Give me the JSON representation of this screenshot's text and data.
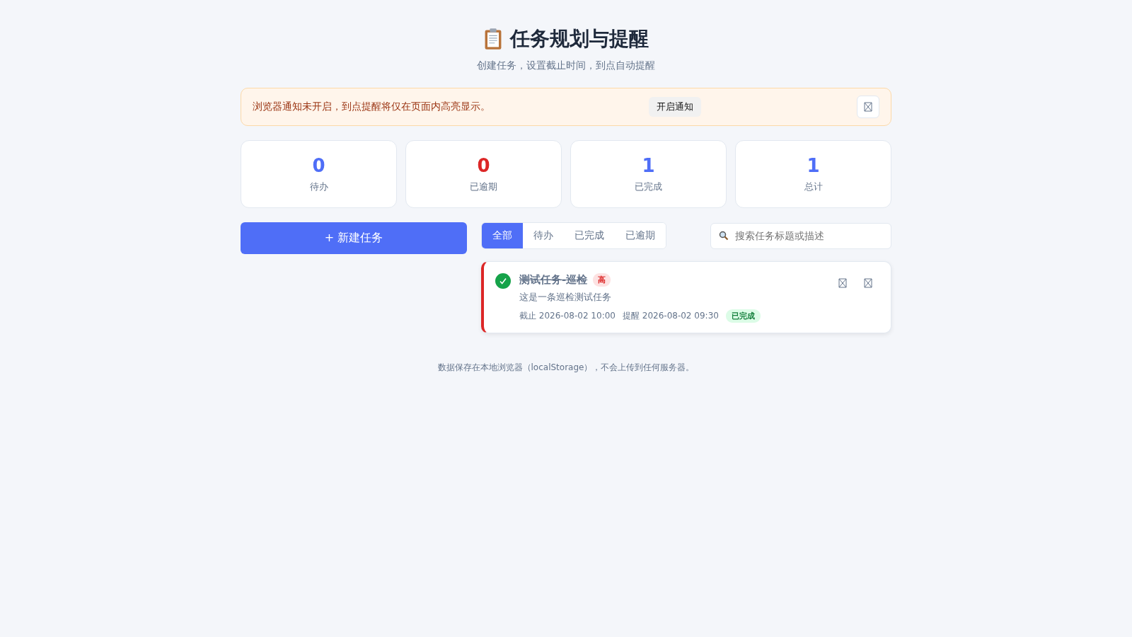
{
  "header": {
    "title": "任务规划与提醒",
    "subtitle": "创建任务，设置截止时间，到点自动提醒"
  },
  "notice": {
    "text": "浏览器通知未开启，到点提醒将仅在页面内高亮显示。",
    "button": "开启通知"
  },
  "stats": [
    {
      "value": "0",
      "label": "待办",
      "color": "#4f6ef7"
    },
    {
      "value": "0",
      "label": "已逾期",
      "color": "#dc2626"
    },
    {
      "value": "1",
      "label": "已完成",
      "color": "#4f6ef7"
    },
    {
      "value": "1",
      "label": "总计",
      "color": "#4f6ef7"
    }
  ],
  "new_task_button": "+ 新建任务",
  "filters": [
    {
      "label": "全部",
      "selected": true
    },
    {
      "label": "待办",
      "selected": false
    },
    {
      "label": "已完成",
      "selected": false
    },
    {
      "label": "已逾期",
      "selected": false
    }
  ],
  "search": {
    "placeholder": "搜索任务标题或描述"
  },
  "tasks": [
    {
      "title": "测试任务-巡检",
      "done": true,
      "priority": "高",
      "color": "#dc2626",
      "description": "这是一条巡检测试任务",
      "due": "截止 2026-08-02 10:00",
      "remind": "提醒 2026-08-02 09:30",
      "status": "已完成"
    }
  ],
  "footer": "数据保存在本地浏览器（localStorage），不会上传到任何服务器。"
}
